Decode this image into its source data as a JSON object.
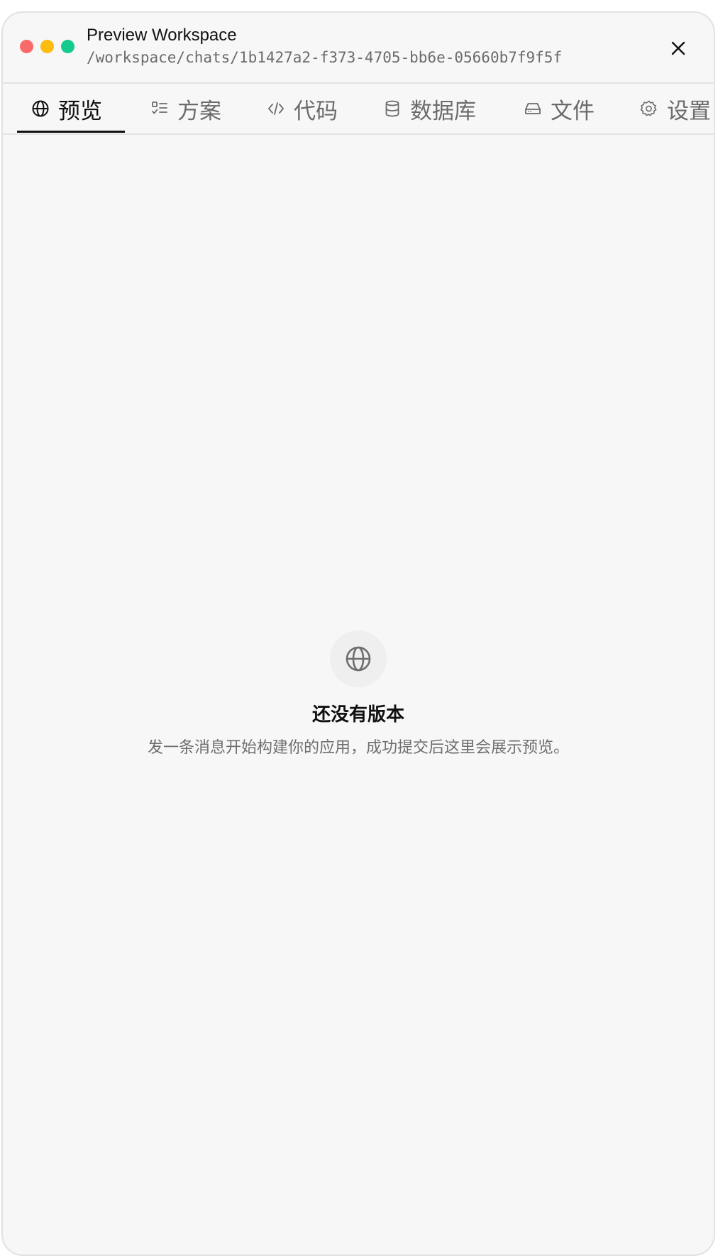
{
  "window": {
    "title": "Preview Workspace",
    "path": "/workspace/chats/1b1427a2-f373-4705-bb6e-05660b7f9f5f"
  },
  "tabs": [
    {
      "label": "预览",
      "icon": "globe-icon",
      "active": true
    },
    {
      "label": "方案",
      "icon": "checklist-icon",
      "active": false
    },
    {
      "label": "代码",
      "icon": "code-icon",
      "active": false
    },
    {
      "label": "数据库",
      "icon": "database-icon",
      "active": false
    },
    {
      "label": "文件",
      "icon": "drive-icon",
      "active": false
    },
    {
      "label": "设置",
      "icon": "gear-icon",
      "active": false
    }
  ],
  "empty_state": {
    "icon": "globe-icon",
    "title": "还没有版本",
    "subtitle": "发一条消息开始构建你的应用，成功提交后这里会展示预览。"
  },
  "colors": {
    "traffic_red": "#fb6a6a",
    "traffic_yellow": "#fdbc10",
    "traffic_green": "#16c98d",
    "background": "#f7f7f7"
  }
}
